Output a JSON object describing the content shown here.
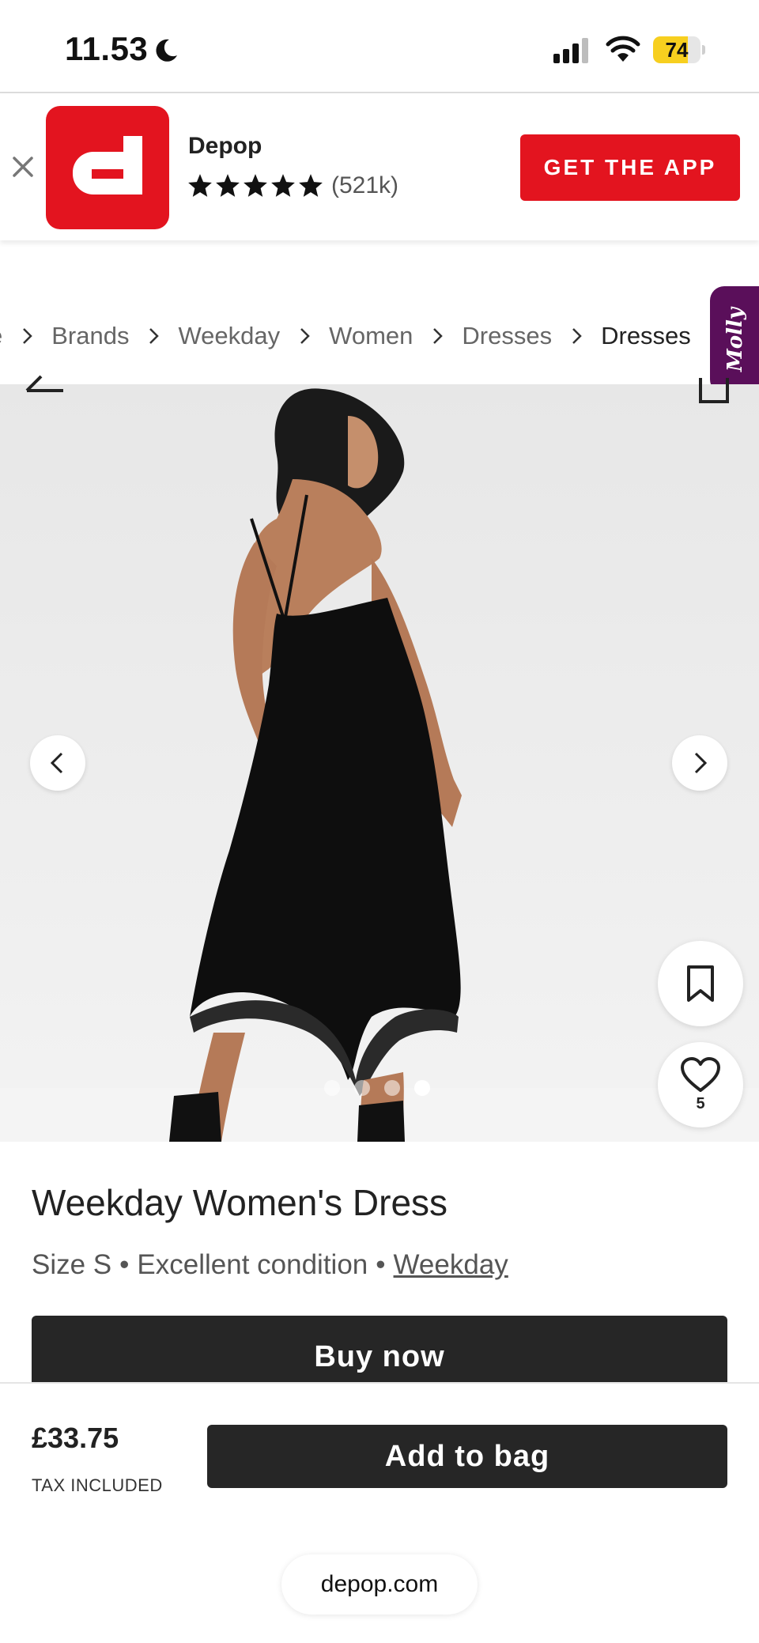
{
  "status_bar": {
    "time": "11.53",
    "battery_level": "74",
    "battery_fraction": 0.74,
    "icons": [
      "moon-icon",
      "signal-icon",
      "wifi-icon",
      "battery-icon"
    ]
  },
  "app_banner": {
    "app_name": "Depop",
    "rating_count": "(521k)",
    "stars": 5,
    "cta_label": "GET THE APP",
    "brand_color": "#e3141f"
  },
  "breadcrumb": {
    "items": [
      "e",
      "Brands",
      "Weekday",
      "Women",
      "Dresses",
      "Dresses"
    ]
  },
  "molly_tab": {
    "label": "Molly",
    "color": "#5a0f5a"
  },
  "gallery": {
    "image_count": 4,
    "active_index": 3,
    "like_count": "5"
  },
  "product": {
    "title": "Weekday Women's Dress",
    "size": "Size S",
    "condition": "Excellent condition",
    "brand": "Weekday",
    "buy_now_label": "Buy now"
  },
  "footer": {
    "price": "£33.75",
    "tax_note": "TAX INCLUDED",
    "add_to_bag_label": "Add to bag"
  },
  "browser": {
    "url": "depop.com"
  }
}
